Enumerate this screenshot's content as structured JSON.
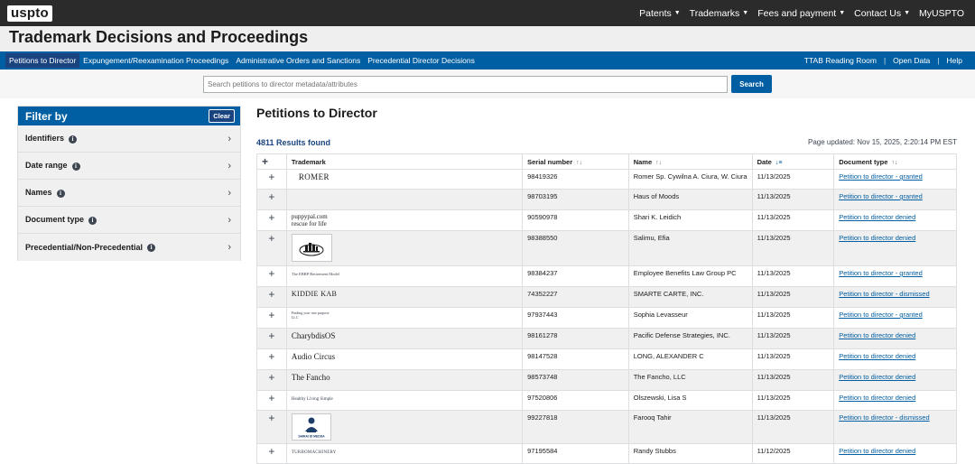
{
  "topbar": {
    "logo": "uspto",
    "nav": [
      {
        "label": "Patents",
        "has_caret": true
      },
      {
        "label": "Trademarks",
        "has_caret": true
      },
      {
        "label": "Fees and payment",
        "has_caret": true
      },
      {
        "label": "Contact Us",
        "has_caret": true
      },
      {
        "label": "MyUSPTO",
        "has_caret": false
      }
    ]
  },
  "header": {
    "title": "Trademark Decisions and Proceedings"
  },
  "subnav": {
    "left": [
      {
        "label": "Petitions to Director",
        "active": true
      },
      {
        "label": "Expungement/Reexamination Proceedings",
        "active": false
      },
      {
        "label": "Administrative Orders and Sanctions",
        "active": false
      },
      {
        "label": "Precedential Director Decisions",
        "active": false
      }
    ],
    "right": [
      "TTAB Reading Room",
      "Open Data",
      "Help"
    ]
  },
  "search": {
    "placeholder": "Search petitions to director metadata/attributes",
    "button_label": "Search"
  },
  "filter": {
    "title": "Filter by",
    "clear_label": "Clear",
    "groups": [
      "Identifiers",
      "Date range",
      "Names",
      "Document type",
      "Precedential/Non-Precedential"
    ]
  },
  "main": {
    "title": "Petitions to Director",
    "results_label": "4811 Results found",
    "updated_label": "Page updated: Nov 15, 2025, 2:20:14 PM EST",
    "columns": [
      "Trademark",
      "Serial number",
      "Name",
      "Date",
      "Document type"
    ],
    "rows": [
      {
        "trademark": "ROMER",
        "mark_style": "big",
        "serial": "98419326",
        "name": "Romer Sp. Cywilna A. Ciura, W. Ciura",
        "date": "11/13/2025",
        "doc_type": "Petition to director - granted"
      },
      {
        "trademark": "",
        "mark_style": "none",
        "serial": "98703195",
        "name": "Haus of Moods",
        "date": "11/13/2025",
        "doc_type": "Petition to director - granted"
      },
      {
        "trademark": "puppypal.com rescue for life",
        "mark_style": "wrap",
        "serial": "90590978",
        "name": "Shari K. Leidich",
        "date": "11/13/2025",
        "doc_type": "Petition to director denied"
      },
      {
        "trademark": "",
        "mark_style": "image-skyline",
        "serial": "98388550",
        "name": "Salimu, Efia",
        "date": "11/13/2025",
        "doc_type": "Petition to director denied"
      },
      {
        "trademark": "The EBRP Retirement Model",
        "mark_style": "small",
        "serial": "98384237",
        "name": "Employee Benefits Law Group PC",
        "date": "11/13/2025",
        "doc_type": "Petition to director - granted"
      },
      {
        "trademark": "KIDDIE KAB",
        "mark_style": "big",
        "serial": "74352227",
        "name": "SMARTE CARTE, INC.",
        "date": "11/13/2025",
        "doc_type": "Petition to director - dismissed"
      },
      {
        "trademark": "Finding your true purpose LLC",
        "mark_style": "wrap-small",
        "serial": "97937443",
        "name": "Sophia Levasseur",
        "date": "11/13/2025",
        "doc_type": "Petition to director - granted"
      },
      {
        "trademark": "CharybdisOS",
        "mark_style": "big",
        "serial": "98161278",
        "name": "Pacific Defense Strategies, INC.",
        "date": "11/13/2025",
        "doc_type": "Petition to director denied"
      },
      {
        "trademark": "Audio Circus",
        "mark_style": "big",
        "serial": "98147528",
        "name": "LONG, ALEXANDER C",
        "date": "11/13/2025",
        "doc_type": "Petition to director denied"
      },
      {
        "trademark": "The Fancho",
        "mark_style": "big",
        "serial": "98573748",
        "name": "The Fancho, LLC",
        "date": "11/13/2025",
        "doc_type": "Petition to director denied"
      },
      {
        "trademark": "Healthy Living Simple",
        "mark_style": "small",
        "serial": "97520806",
        "name": "Olszewski, Lisa S",
        "date": "11/13/2025",
        "doc_type": "Petition to director denied"
      },
      {
        "trademark": "SHIRAI DI MEDDA",
        "mark_style": "image-figure",
        "serial": "99227818",
        "name": "Farooq Tahir",
        "date": "11/13/2025",
        "doc_type": "Petition to director - dismissed"
      },
      {
        "trademark": "TURBOMACHINERY",
        "mark_style": "small",
        "serial": "97195584",
        "name": "Randy Stubbs",
        "date": "11/12/2025",
        "doc_type": "Petition to director denied"
      }
    ]
  },
  "colors": {
    "topbar": "#2b2b2b",
    "primary": "#005ea2",
    "active_tab": "#1a4480",
    "link": "#005ea2"
  }
}
